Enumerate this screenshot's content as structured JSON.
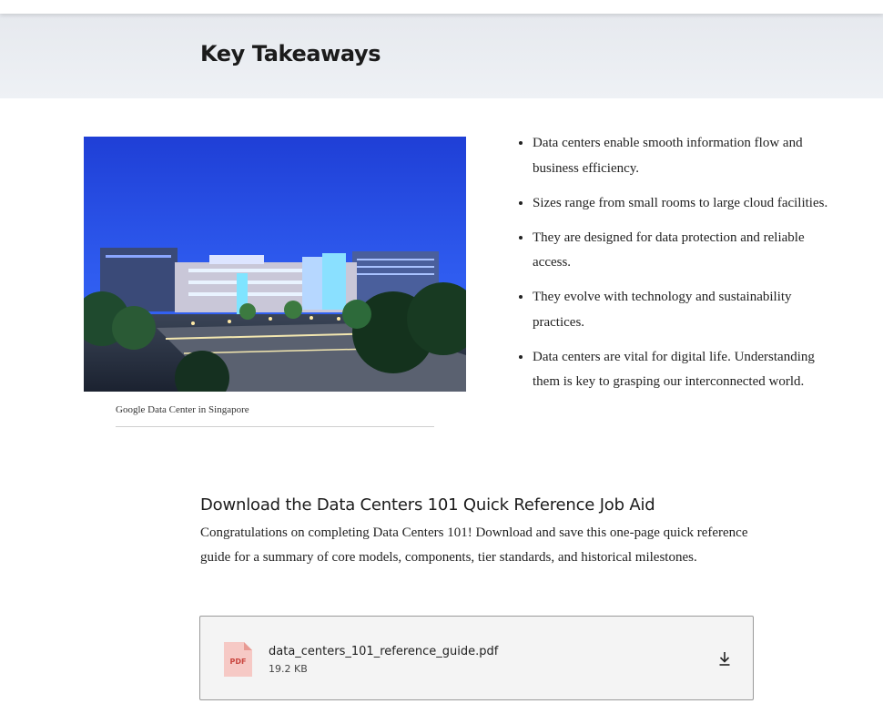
{
  "section": {
    "title": "Key Takeaways"
  },
  "image": {
    "caption": "Google Data Center in Singapore"
  },
  "takeaways": [
    "Data centers enable smooth information flow and business efficiency.",
    "Sizes range from small rooms to large cloud facilities.",
    "They are designed for data protection and reliable access.",
    "They evolve with technology and sustainability practices.",
    "Data centers are vital for digital life. Understanding them is key to grasping our interconnected world."
  ],
  "download": {
    "heading": "Download the Data Centers 101 Quick Reference Job Aid",
    "description": "Congratulations on completing Data Centers 101! Download and save this one-page quick reference guide for a summary of core models, components, tier standards, and historical milestones.",
    "file": {
      "name": "data_centers_101_reference_guide.pdf",
      "size": "19.2 KB",
      "type_label": "PDF",
      "icon": "pdf-file-icon",
      "action_icon": "download-icon"
    }
  },
  "colors": {
    "hero_background": "#e9ecf1",
    "pdf_accent": "#d9534f",
    "pdf_fill": "#f6c9c5",
    "card_border": "#9a9a9a"
  }
}
